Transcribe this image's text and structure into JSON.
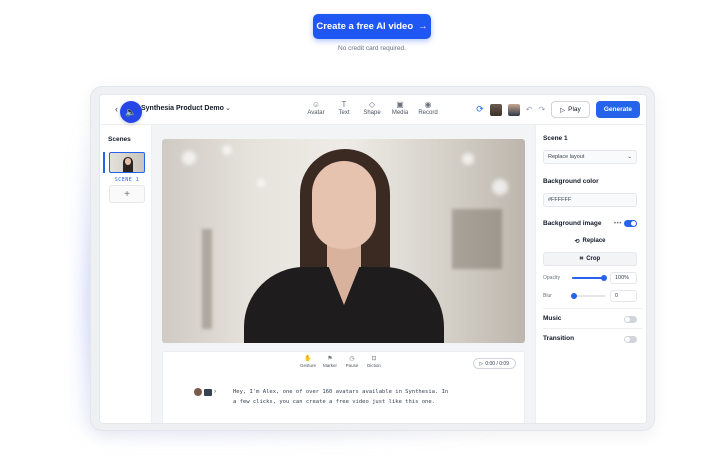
{
  "cta": {
    "label": "Create a free AI video",
    "arrow": "→",
    "note": "No credit card required."
  },
  "topbar": {
    "back": "‹",
    "title": "Synthesia Product Demo",
    "title_chevron": "⌄",
    "tools": [
      {
        "icon": "☺",
        "label": "Avatar"
      },
      {
        "icon": "T",
        "label": "Text"
      },
      {
        "icon": "◇",
        "label": "Shape"
      },
      {
        "icon": "▣",
        "label": "Media"
      },
      {
        "icon": "◉",
        "label": "Record"
      }
    ],
    "play_icon": "▷",
    "play_label": "Play",
    "generate_label": "Generate"
  },
  "scenes": {
    "heading": "Scenes",
    "items": [
      {
        "label": "SCENE 1"
      }
    ],
    "add": "+"
  },
  "mute_icon": "🔈",
  "script": {
    "tools": [
      {
        "icon": "✋",
        "label": "Gesture"
      },
      {
        "icon": "⚑",
        "label": "Marker"
      },
      {
        "icon": "◷",
        "label": "Pause"
      },
      {
        "icon": "⊡",
        "label": "Diction"
      }
    ],
    "timer_icon": "▷",
    "timer": "0:00 / 0:09",
    "language": "EN",
    "line1": "Hey, I'm Alex, one of over 160 avatars available in Synthesia. In",
    "line2": "a few clicks, you can create a free video just like this one."
  },
  "panel": {
    "scene_title": "Scene 1",
    "layout_select": "Replace layout",
    "bg_color_heading": "Background color",
    "bg_color_value": "#FFFFFF",
    "bg_image_heading": "Background image",
    "bg_image_on": true,
    "replace_label": "Replace",
    "crop_label": "Crop",
    "opacity_label": "Opacity",
    "opacity_value": "100%",
    "blur_label": "Blur",
    "blur_value": "0",
    "music_label": "Music",
    "music_on": false,
    "transition_label": "Transition",
    "transition_on": false
  },
  "colors": {
    "accent": "#2563eb",
    "cta": "#1f57f5"
  }
}
